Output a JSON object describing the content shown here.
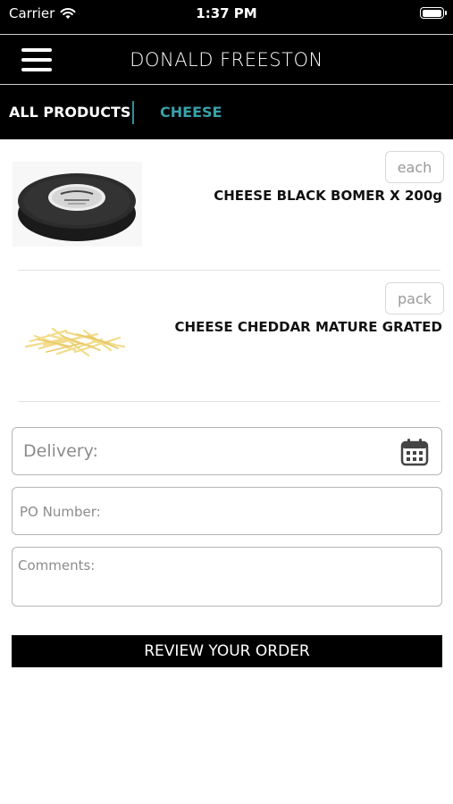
{
  "status_bar": {
    "carrier": "Carrier",
    "time": "1:37 PM",
    "battery_level": 1.0,
    "icons": [
      "wifi-icon",
      "battery-icon"
    ]
  },
  "nav": {
    "title": "DONALD FREESTON",
    "menu_icon": "hamburger-menu-icon"
  },
  "tabs": {
    "all_label": "ALL PRODUCTS",
    "current_label": "CHEESE",
    "current_color": "#3aa0aa"
  },
  "products": [
    {
      "name": "CHEESE BLACK BOMER X 200g",
      "unit": "each",
      "image": "black-wax-cheese-wheel"
    },
    {
      "name": "CHEESE CHEDDAR MATURE GRATED",
      "unit": "pack",
      "image": "grated-cheddar"
    }
  ],
  "form": {
    "delivery_placeholder": "Delivery:",
    "delivery_icon": "calendar-icon",
    "po_placeholder": "PO Number:",
    "comments_placeholder": "Comments:"
  },
  "review_button": "REVIEW YOUR ORDER"
}
